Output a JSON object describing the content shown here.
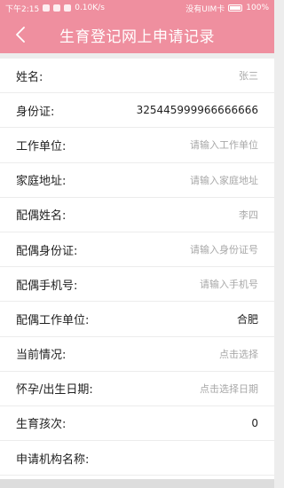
{
  "status_bar": {
    "time": "下午2:15",
    "speed": "0.10K/s",
    "carrier": "没有UIM卡",
    "battery": "100%"
  },
  "header": {
    "title": "生育登记网上申请记录",
    "back_icon": "chevron-left-icon"
  },
  "colors": {
    "header_bg": "#ef8f9f",
    "page_bg": "#ededed",
    "placeholder": "#a8a8a8"
  },
  "form": {
    "rows": [
      {
        "label": "姓名:",
        "value": "张三",
        "filled": false
      },
      {
        "label": "身份证:",
        "value": "325445999966666666",
        "filled": true
      },
      {
        "label": "工作单位:",
        "value": "请输入工作单位",
        "filled": false
      },
      {
        "label": "家庭地址:",
        "value": "请输入家庭地址",
        "filled": false
      },
      {
        "label": "配偶姓名:",
        "value": "李四",
        "filled": false
      },
      {
        "label": "配偶身份证:",
        "value": "请输入身份证号",
        "filled": false
      },
      {
        "label": "配偶手机号:",
        "value": "请输入手机号",
        "filled": false
      },
      {
        "label": "配偶工作单位:",
        "value": "合肥",
        "filled": true
      },
      {
        "label": "当前情况:",
        "value": "点击选择",
        "filled": false
      },
      {
        "label": "怀孕/出生日期:",
        "value": "点击选择日期",
        "filled": false
      },
      {
        "label": "生育孩次:",
        "value": "0",
        "filled": true
      },
      {
        "label": "申请机构名称:",
        "value": "",
        "filled": false
      }
    ]
  }
}
